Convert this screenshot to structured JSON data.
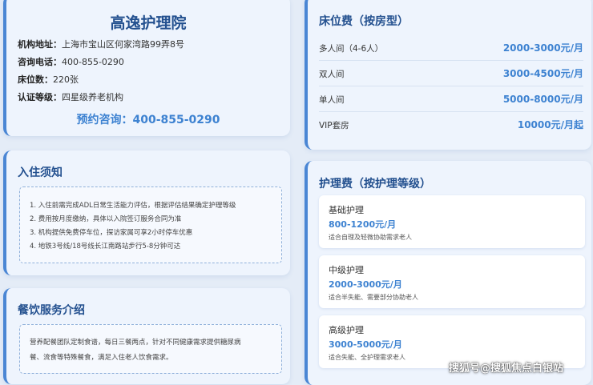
{
  "institution": {
    "name": "高逸护理院",
    "address_label": "机构地址：",
    "address": "上海市宝山区何家湾路99弄8号",
    "phone_label": "咨询电话：",
    "phone": "400-855-0290",
    "beds_label": "床位数：",
    "beds": "220张",
    "level_label": "认证等级：",
    "level": "四星级养老机构",
    "consult": "预约咨询：400-855-0290"
  },
  "notice": {
    "title": "入住须知",
    "items": [
      "1. 入住前需完成ADL日常生活能力评估，根据评估结果确定护理等级",
      "2. 费用按月度缴纳，具体以入院签订服务合同为准",
      "3. 机构提供免费停车位，探访家属可享2小时停车优惠",
      "4. 地铁3号线/18号线长江南路站步行5-8分钟可达"
    ]
  },
  "food": {
    "title": "餐饮服务介绍",
    "lines": [
      "营养配餐团队定制食谱，每日三餐两点，针对不同健康需求提供糖尿病",
      "餐、流食等特殊餐食，满足入住老人饮食需求。"
    ]
  },
  "bed_fees": {
    "title": "床位费（按房型）",
    "rows": [
      {
        "name": "多人间（4-6人）",
        "price": "2000-3000元/月"
      },
      {
        "name": "双人间",
        "price": "3000-4500元/月"
      },
      {
        "name": "单人间",
        "price": "5000-8000元/月"
      },
      {
        "name": "VIP套房",
        "price": "10000元/月起"
      }
    ]
  },
  "care_fees": {
    "title": "护理费（按护理等级）",
    "items": [
      {
        "name": "基础护理",
        "price": "800-1200元/月",
        "desc": "适合自理及轻微协助需求老人"
      },
      {
        "name": "中级护理",
        "price": "2000-3000元/月",
        "desc": "适合半失能、需要部分协助老人"
      },
      {
        "name": "高级护理",
        "price": "3000-5000元/月",
        "desc": "适合失能、全护理需求老人"
      }
    ]
  },
  "watermark": "搜狐号@搜狐焦点白银站"
}
